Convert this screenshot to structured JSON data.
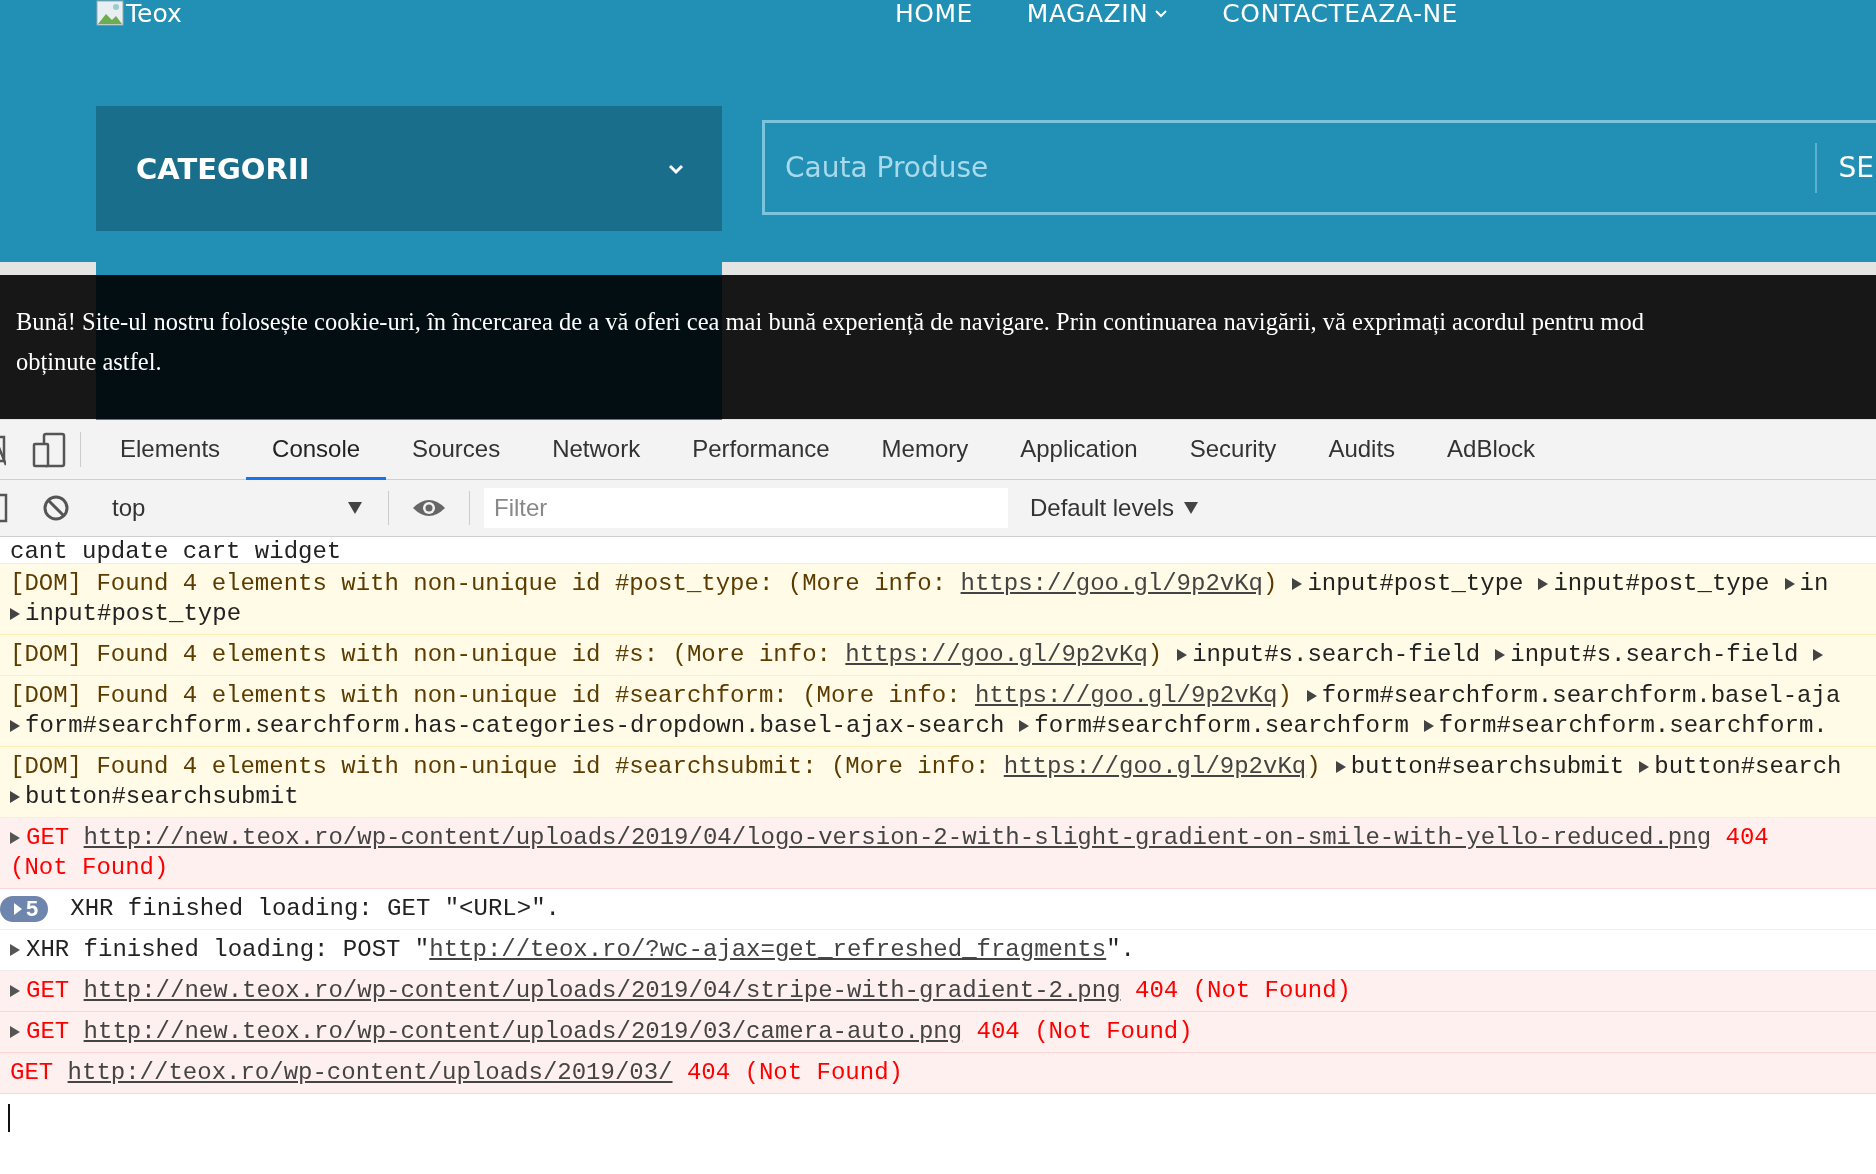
{
  "site": {
    "logo_text": "Teox",
    "nav": [
      {
        "label": "HOME",
        "has_menu": false
      },
      {
        "label": "MAGAZIN",
        "has_menu": true
      },
      {
        "label": "CONTACTEAZA-NE",
        "has_menu": false
      }
    ],
    "categories": {
      "title": "CATEGORII"
    },
    "search": {
      "placeholder": "Cauta Produse",
      "button": "SE"
    },
    "cookie_notice": {
      "lines": [
        "Bună! Site-ul nostru folosește cookie-uri, în încercarea de a vă oferi cea mai bună experiență de navigare. Prin continuarea navigării, vă exprimați acordul pentru mod",
        "obținute astfel."
      ]
    }
  },
  "devtools": {
    "tabs": [
      {
        "label": "Elements",
        "selected": false
      },
      {
        "label": "Console",
        "selected": true
      },
      {
        "label": "Sources",
        "selected": false
      },
      {
        "label": "Network",
        "selected": false
      },
      {
        "label": "Performance",
        "selected": false
      },
      {
        "label": "Memory",
        "selected": false
      },
      {
        "label": "Application",
        "selected": false
      },
      {
        "label": "Security",
        "selected": false
      },
      {
        "label": "Audits",
        "selected": false
      },
      {
        "label": "AdBlock",
        "selected": false
      }
    ],
    "context": "top",
    "filter": {
      "placeholder": "Filter"
    },
    "levels": "Default levels",
    "messages": [
      {
        "kind": "info",
        "expandable": false,
        "lines": [
          {
            "segments": [
              {
                "kind": "text",
                "text": "cant update cart widget"
              }
            ]
          }
        ]
      },
      {
        "kind": "warning",
        "expandable": false,
        "lines": [
          {
            "segments": [
              {
                "kind": "text",
                "text": "[DOM] Found 4 elements with non-unique id #post_type: (More info: "
              },
              {
                "kind": "link",
                "text": "https://goo.gl/9p2vKq"
              },
              {
                "kind": "text",
                "text": ")"
              },
              {
                "kind": "node",
                "text": "input#post_type"
              },
              {
                "kind": "node",
                "text": "input#post_type"
              },
              {
                "kind": "node",
                "text": "in"
              }
            ]
          },
          {
            "segments": [
              {
                "kind": "node",
                "text": "input#post_type"
              }
            ]
          }
        ]
      },
      {
        "kind": "warning",
        "expandable": false,
        "lines": [
          {
            "segments": [
              {
                "kind": "text",
                "text": "[DOM] Found 4 elements with non-unique id #s: (More info: "
              },
              {
                "kind": "link",
                "text": "https://goo.gl/9p2vKq"
              },
              {
                "kind": "text",
                "text": ")"
              },
              {
                "kind": "node",
                "text": "input#s.search-field"
              },
              {
                "kind": "node",
                "text": "input#s.search-field"
              }
            ],
            "trailing_arrow": true
          }
        ]
      },
      {
        "kind": "warning",
        "expandable": false,
        "lines": [
          {
            "segments": [
              {
                "kind": "text",
                "text": "[DOM] Found 4 elements with non-unique id #searchform: (More info: "
              },
              {
                "kind": "link",
                "text": "https://goo.gl/9p2vKq"
              },
              {
                "kind": "text",
                "text": ")"
              },
              {
                "kind": "node",
                "text": "form#searchform.searchform.basel-aja"
              }
            ]
          },
          {
            "segments": [
              {
                "kind": "node",
                "text": "form#searchform.searchform.has-categories-dropdown.basel-ajax-search"
              },
              {
                "kind": "node",
                "text": "form#searchform.searchform"
              },
              {
                "kind": "node",
                "text": "form#searchform.searchform."
              }
            ]
          }
        ]
      },
      {
        "kind": "warning",
        "expandable": false,
        "lines": [
          {
            "segments": [
              {
                "kind": "text",
                "text": "[DOM] Found 4 elements with non-unique id #searchsubmit: (More info: "
              },
              {
                "kind": "link",
                "text": "https://goo.gl/9p2vKq"
              },
              {
                "kind": "text",
                "text": ")"
              },
              {
                "kind": "node",
                "text": "button#searchsubmit"
              },
              {
                "kind": "node",
                "text": "button#search"
              }
            ]
          },
          {
            "segments": [
              {
                "kind": "node",
                "text": "button#searchsubmit"
              }
            ]
          }
        ]
      },
      {
        "kind": "error",
        "expandable": true,
        "lines": [
          {
            "segments": [
              {
                "kind": "text",
                "text": "GET "
              },
              {
                "kind": "link",
                "text": "http://new.teox.ro/wp-content/uploads/2019/04/logo-version-2-with-slight-gradient-on-smile-with-yello-reduced.png"
              },
              {
                "kind": "text",
                "text": " 404"
              }
            ]
          },
          {
            "segments": [
              {
                "kind": "text",
                "text": "(Not Found)"
              }
            ]
          }
        ]
      },
      {
        "kind": "info",
        "expandable": true,
        "count": "5",
        "lines": [
          {
            "segments": [
              {
                "kind": "text",
                "text": "XHR finished loading: GET \"<URL>\"."
              }
            ]
          }
        ]
      },
      {
        "kind": "info",
        "expandable": true,
        "lines": [
          {
            "segments": [
              {
                "kind": "text",
                "text": "XHR finished loading: POST \""
              },
              {
                "kind": "link",
                "text": "http://teox.ro/?wc-ajax=get_refreshed_fragments"
              },
              {
                "kind": "text",
                "text": "\"."
              }
            ]
          }
        ]
      },
      {
        "kind": "error",
        "expandable": true,
        "lines": [
          {
            "segments": [
              {
                "kind": "text",
                "text": "GET "
              },
              {
                "kind": "link",
                "text": "http://new.teox.ro/wp-content/uploads/2019/04/stripe-with-gradient-2.png"
              },
              {
                "kind": "text",
                "text": " 404 (Not Found)"
              }
            ]
          }
        ]
      },
      {
        "kind": "error",
        "expandable": true,
        "lines": [
          {
            "segments": [
              {
                "kind": "text",
                "text": "GET "
              },
              {
                "kind": "link",
                "text": "http://new.teox.ro/wp-content/uploads/2019/03/camera-auto.png"
              },
              {
                "kind": "text",
                "text": " 404 (Not Found)"
              }
            ]
          }
        ]
      },
      {
        "kind": "error",
        "expandable": false,
        "lines": [
          {
            "segments": [
              {
                "kind": "text",
                "text": "GET "
              },
              {
                "kind": "link",
                "text": "http://teox.ro/wp-content/uploads/2019/03/"
              },
              {
                "kind": "text",
                "text": " 404 (Not Found)"
              }
            ]
          }
        ]
      }
    ]
  }
}
